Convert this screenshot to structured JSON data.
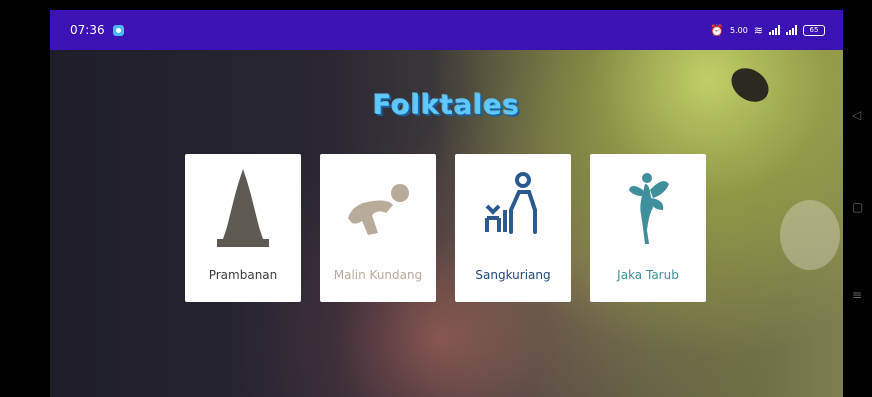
{
  "status_bar": {
    "time": "07:36",
    "speed": "5.00",
    "battery": "65",
    "color": "#3b12b4"
  },
  "app": {
    "title": "Folktales"
  },
  "stories": [
    {
      "label": "Prambanan",
      "icon": "temple-icon",
      "color": "#5e5a52"
    },
    {
      "label": "Malin Kundang",
      "icon": "kneeling-man-icon",
      "color": "#b8ab9a"
    },
    {
      "label": "Sangkuriang",
      "icon": "person-building-icon",
      "color": "#2a5a8e"
    },
    {
      "label": "Jaka Tarub",
      "icon": "fairy-icon",
      "color": "#3f8f9c"
    }
  ],
  "nav_bar": {
    "back": "back-icon",
    "home": "home-icon",
    "recents": "recents-icon"
  }
}
